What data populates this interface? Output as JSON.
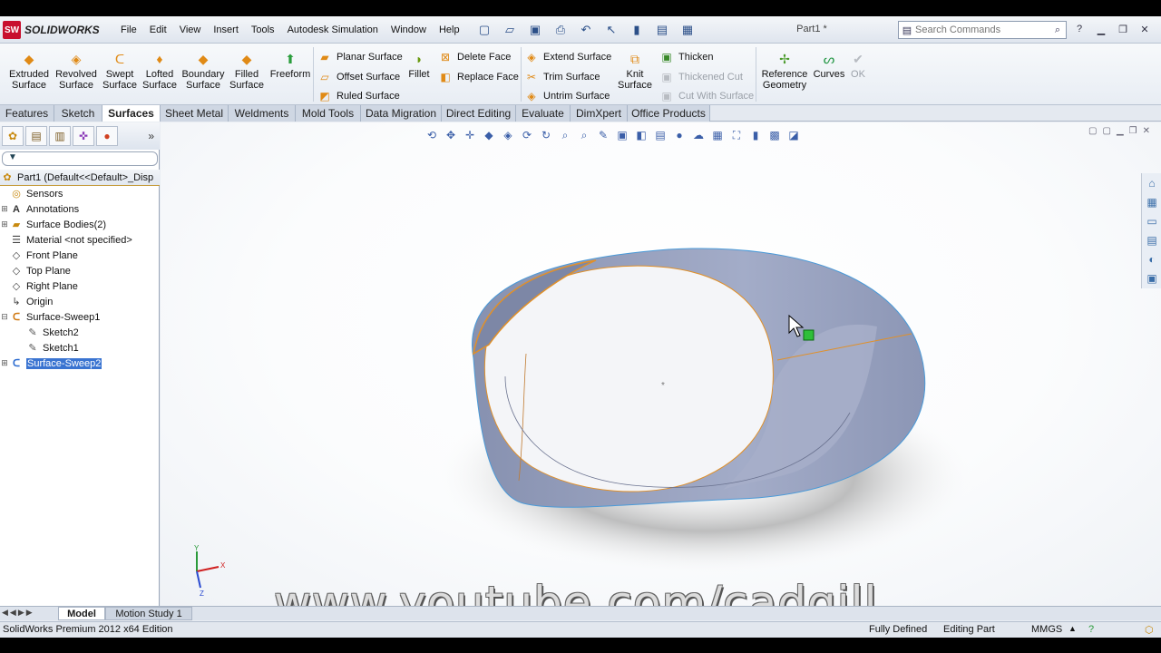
{
  "app": {
    "logo_badge": "SW",
    "logo_text": "SOLIDWORKS",
    "doc_title": "Part1 *"
  },
  "menus": [
    "File",
    "Edit",
    "View",
    "Insert",
    "Tools",
    "Autodesk Simulation",
    "Window",
    "Help"
  ],
  "search": {
    "placeholder": "Search Commands"
  },
  "ribbon": {
    "extruded": "Extruded Surface",
    "revolved": "Revolved Surface",
    "swept": "Swept Surface",
    "lofted": "Lofted Surface",
    "boundary": "Boundary Surface",
    "filled": "Filled Surface",
    "freeform": "Freeform",
    "planar": "Planar Surface",
    "offset": "Offset Surface",
    "ruled": "Ruled Surface",
    "fillet": "Fillet",
    "delete_face": "Delete Face",
    "replace_face": "Replace Face",
    "extend": "Extend Surface",
    "trim": "Trim Surface",
    "untrim": "Untrim Surface",
    "knit": "Knit Surface",
    "thicken": "Thicken",
    "thickened_cut": "Thickened Cut",
    "cut_with_surface": "Cut With Surface",
    "reference_geometry": "Reference Geometry",
    "curves": "Curves",
    "ok": "OK"
  },
  "tabs": [
    "Features",
    "Sketch",
    "Surfaces",
    "Sheet Metal",
    "Weldments",
    "Mold Tools",
    "Data Migration",
    "Direct Editing",
    "Evaluate",
    "DimXpert",
    "Office Products"
  ],
  "active_tab": "Surfaces",
  "tree": {
    "root": "Part1  (Default<<Default>_Disp",
    "items": [
      {
        "label": "Sensors"
      },
      {
        "label": "Annotations"
      },
      {
        "label": "Surface Bodies(2)"
      },
      {
        "label": "Material <not specified>"
      },
      {
        "label": "Front Plane"
      },
      {
        "label": "Top Plane"
      },
      {
        "label": "Right Plane"
      },
      {
        "label": "Origin"
      },
      {
        "label": "Surface-Sweep1"
      },
      {
        "label": "Sketch2"
      },
      {
        "label": "Sketch1"
      },
      {
        "label": "Surface-Sweep2"
      }
    ]
  },
  "model_tabs": [
    "Model",
    "Motion Study 1"
  ],
  "status": {
    "edition": "SolidWorks Premium 2012 x64 Edition",
    "state": "Fully Defined",
    "mode": "Editing Part",
    "units": "MMGS"
  },
  "watermark": "www.youtube.com/cadgill",
  "triad": {
    "x": "X",
    "y": "Y",
    "z": "Z"
  },
  "colors": {
    "accent": "#e08a16",
    "surface": "#9aa4c2",
    "selection": "#3a74d1",
    "edge_orange": "#e0902a",
    "edge_blue": "#4a9ad8"
  }
}
